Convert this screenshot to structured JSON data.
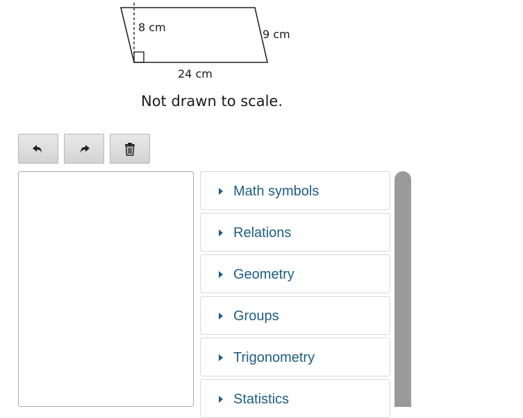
{
  "figure": {
    "labels": {
      "height": "8 cm",
      "side": "9 cm",
      "base": "24 cm"
    },
    "caption": "Not drawn to scale."
  },
  "toolbar": {
    "undo_icon": "undo-icon",
    "redo_icon": "redo-icon",
    "delete_icon": "trash-icon"
  },
  "palette": {
    "items": [
      {
        "label": "Math symbols"
      },
      {
        "label": "Relations"
      },
      {
        "label": "Geometry"
      },
      {
        "label": "Groups"
      },
      {
        "label": "Trigonometry"
      },
      {
        "label": "Statistics"
      }
    ]
  },
  "colors": {
    "accent": "#1d5d86",
    "scrollbar": "#9a9a9a",
    "button_face": "#dedede"
  }
}
